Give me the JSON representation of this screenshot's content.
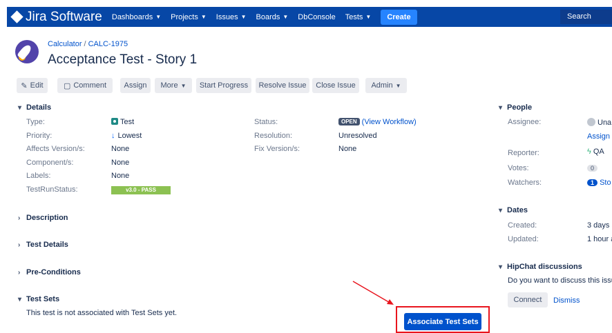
{
  "topbar": {
    "logo": "Jira Software",
    "nav": [
      "Dashboards",
      "Projects",
      "Issues",
      "Boards",
      "DbConsole",
      "Tests"
    ],
    "create": "Create",
    "search_placeholder": "Search"
  },
  "breadcrumb": {
    "project": "Calculator",
    "key": "CALC-1975"
  },
  "issue_title": "Acceptance Test - Story 1",
  "toolbar": {
    "edit": "Edit",
    "comment": "Comment",
    "assign": "Assign",
    "more": "More",
    "start_progress": "Start Progress",
    "resolve": "Resolve Issue",
    "close": "Close Issue",
    "admin": "Admin"
  },
  "details": {
    "heading": "Details",
    "type_label": "Type:",
    "type_value": "Test",
    "priority_label": "Priority:",
    "priority_value": "Lowest",
    "affects_label": "Affects Version/s:",
    "affects_value": "None",
    "component_label": "Component/s:",
    "component_value": "None",
    "labels_label": "Labels:",
    "labels_value": "None",
    "testrun_label": "TestRunStatus:",
    "testrun_value": "v3.0 - PASS",
    "status_label": "Status:",
    "status_value": "OPEN",
    "workflow_link": "(View Workflow)",
    "resolution_label": "Resolution:",
    "resolution_value": "Unresolved",
    "fix_label": "Fix Version/s:",
    "fix_value": "None"
  },
  "sections": {
    "description": "Description",
    "test_details": "Test Details",
    "preconditions": "Pre-Conditions",
    "test_sets": "Test Sets",
    "test_sets_empty": "This test is not associated with Test Sets yet.",
    "associate_button": "Associate Test Sets"
  },
  "people": {
    "heading": "People",
    "assignee_label": "Assignee:",
    "assignee_value": "Una",
    "assign_link": "Assign t",
    "reporter_label": "Reporter:",
    "reporter_value": "QA",
    "votes_label": "Votes:",
    "votes_value": "0",
    "watchers_label": "Watchers:",
    "watchers_count": "1",
    "watchers_text": "Sto"
  },
  "dates": {
    "heading": "Dates",
    "created_label": "Created:",
    "created_value": "3 days a",
    "updated_label": "Updated:",
    "updated_value": "1 hour a"
  },
  "hipchat": {
    "heading": "HipChat discussions",
    "text": "Do you want to discuss this issu",
    "connect": "Connect",
    "dismiss": "Dismiss"
  },
  "colors": {
    "topbar": "#0747a6",
    "primary": "#0052cc",
    "highlight": "#e8141d",
    "pass": "#8cc152"
  }
}
